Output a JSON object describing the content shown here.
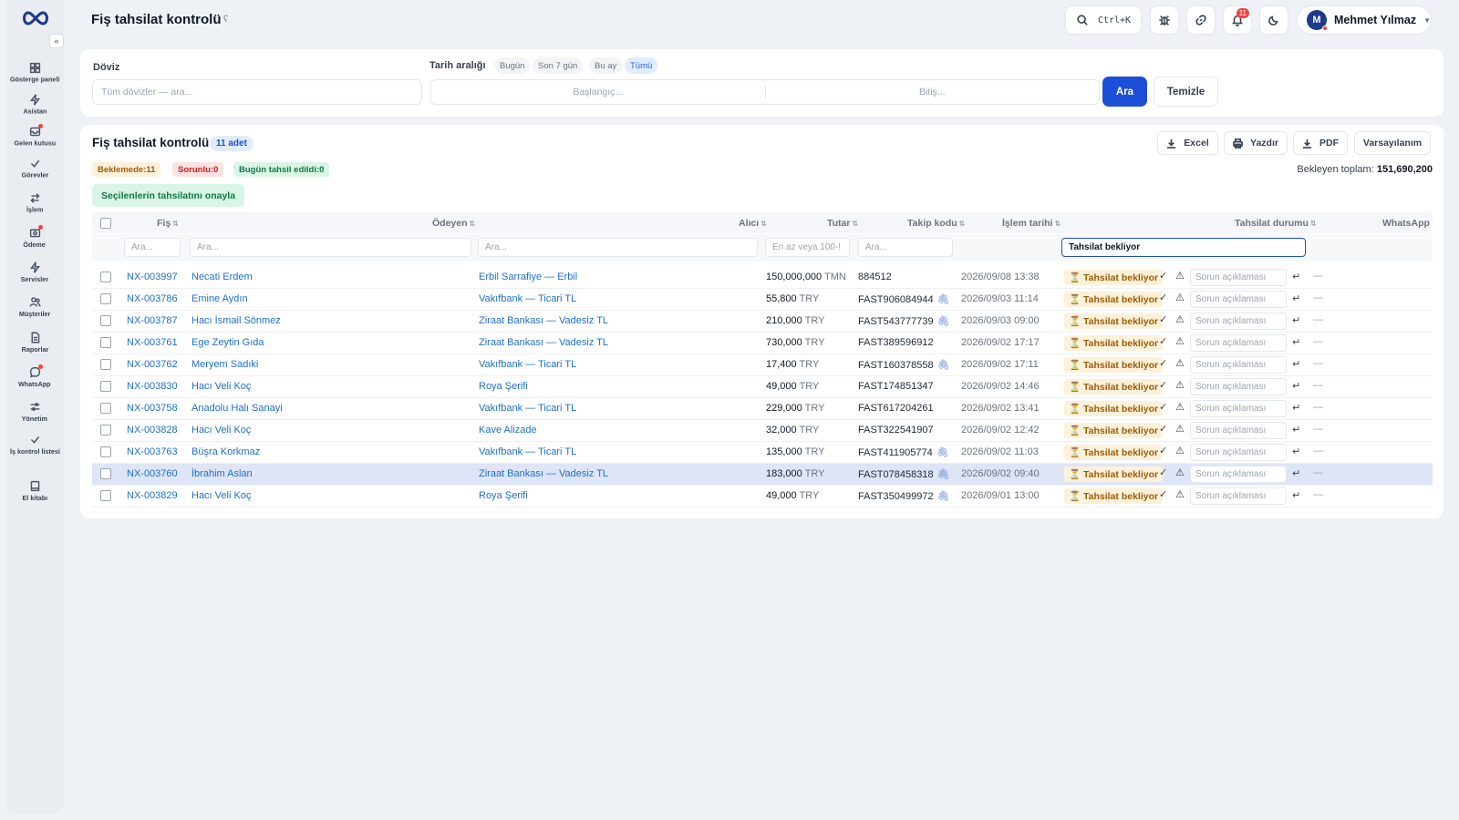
{
  "app": {
    "title": "Fiş tahsilat kontrolü"
  },
  "sidebar": {
    "items": [
      {
        "label": "Gösterge paneli",
        "icon": "dashboard-icon"
      },
      {
        "label": "Asistan",
        "icon": "bolt-icon"
      },
      {
        "label": "Gelen kutusu",
        "icon": "inbox-icon"
      },
      {
        "label": "Görevler",
        "icon": "check-icon"
      },
      {
        "label": "İşlem",
        "icon": "swap-icon"
      },
      {
        "label": "Ödeme",
        "icon": "payment-icon"
      },
      {
        "label": "Servisler",
        "icon": "bolt-icon"
      },
      {
        "label": "Müşteriler",
        "icon": "users-icon"
      },
      {
        "label": "Raporlar",
        "icon": "report-icon"
      },
      {
        "label": "WhatsApp",
        "icon": "chat-icon"
      },
      {
        "label": "Yönetim",
        "icon": "sliders-icon"
      },
      {
        "label": "İş kontrol listesi",
        "icon": "check-icon"
      },
      {
        "label": "El kitabı",
        "icon": "book-icon"
      }
    ]
  },
  "header": {
    "shortcut": "Ctrl+K",
    "notifications": "11",
    "user": {
      "initial": "M",
      "name": "Mehmet Yılmaz"
    }
  },
  "filters": {
    "currency_label": "Döviz",
    "currency_placeholder": "Tüm dövizler — ara...",
    "date_label": "Tarih aralığı",
    "presets": [
      "Bugün",
      "Son 7 gün",
      "Bu ay",
      "Tümü"
    ],
    "start_placeholder": "Başlangıç...",
    "end_placeholder": "Bitiş...",
    "search_button": "Ara",
    "clear_button": "Temizle"
  },
  "main": {
    "title": "Fiş tahsilat kontrolü",
    "count": "11 adet",
    "toolbar": {
      "excel": "Excel",
      "print": "Yazdır",
      "pdf": "PDF",
      "defaults": "Varsayılanım"
    },
    "stats": {
      "pending": "Beklemede:11",
      "problem": "Sorunlu:0",
      "today": "Bugün tahsil edildi:0"
    },
    "total_label": "Bekleyen toplam:",
    "total_value": "151,690,200",
    "approve_button": "Seçilenlerin tahsilatını onayla"
  },
  "table": {
    "columns": {
      "fis": "Fiş",
      "payer": "Ödeyen",
      "receiver": "Alıcı",
      "amount": "Tutar",
      "tracking": "Takip kodu",
      "date": "İşlem tarihi",
      "status": "Tahsilat durumu",
      "whatsapp": "WhatsApp"
    },
    "filters": {
      "fis": "Ara...",
      "payer": "Ara...",
      "receiver": "Ara...",
      "amount": "En az veya 100-!",
      "tracking": "Ara...",
      "status": "Tahsilat bekliyor"
    },
    "status_text": "Tahsilat bekliyor",
    "issue_placeholder": "Sorun açıklaması",
    "rows": [
      {
        "fis": "NX-003997",
        "payer": "Necati Erdem",
        "receiver": "Erbil Sarrafiye — Erbil",
        "amount": "150,000,000",
        "ccy": "TMN",
        "tracking": "884512",
        "clip": false,
        "date": "2026/09/08 13:38"
      },
      {
        "fis": "NX-003786",
        "payer": "Emine Aydın",
        "receiver": "Vakıfbank — Ticari TL",
        "amount": "55,800",
        "ccy": "TRY",
        "tracking": "FAST906084944",
        "clip": true,
        "date": "2026/09/03 11:14"
      },
      {
        "fis": "NX-003787",
        "payer": "Hacı İsmail Sönmez",
        "receiver": "Ziraat Bankası — Vadesiz TL",
        "amount": "210,000",
        "ccy": "TRY",
        "tracking": "FAST543777739",
        "clip": true,
        "date": "2026/09/03 09:00"
      },
      {
        "fis": "NX-003761",
        "payer": "Ege Zeytin Gıda",
        "receiver": "Ziraat Bankası — Vadesiz TL",
        "amount": "730,000",
        "ccy": "TRY",
        "tracking": "FAST389596912",
        "clip": false,
        "date": "2026/09/02 17:17"
      },
      {
        "fis": "NX-003762",
        "payer": "Meryem Sadıki",
        "receiver": "Vakıfbank — Ticari TL",
        "amount": "17,400",
        "ccy": "TRY",
        "tracking": "FAST160378558",
        "clip": true,
        "date": "2026/09/02 17:11"
      },
      {
        "fis": "NX-003830",
        "payer": "Hacı Veli Koç",
        "receiver": "Roya Şerifi",
        "amount": "49,000",
        "ccy": "TRY",
        "tracking": "FAST174851347",
        "clip": false,
        "date": "2026/09/02 14:46"
      },
      {
        "fis": "NX-003758",
        "payer": "Anadolu Halı Sanayi",
        "receiver": "Vakıfbank — Ticari TL",
        "amount": "229,000",
        "ccy": "TRY",
        "tracking": "FAST617204261",
        "clip": false,
        "date": "2026/09/02 13:41"
      },
      {
        "fis": "NX-003828",
        "payer": "Hacı Veli Koç",
        "receiver": "Kave Alizade",
        "amount": "32,000",
        "ccy": "TRY",
        "tracking": "FAST322541907",
        "clip": false,
        "date": "2026/09/02 12:42"
      },
      {
        "fis": "NX-003763",
        "payer": "Büşra Korkmaz",
        "receiver": "Vakıfbank — Ticari TL",
        "amount": "135,000",
        "ccy": "TRY",
        "tracking": "FAST411905774",
        "clip": true,
        "date": "2026/09/02 11:03"
      },
      {
        "fis": "NX-003760",
        "payer": "İbrahim Aslan",
        "receiver": "Ziraat Bankası — Vadesiz TL",
        "amount": "183,000",
        "ccy": "TRY",
        "tracking": "FAST078458318",
        "clip": true,
        "date": "2026/09/02 09:40",
        "selected": true
      },
      {
        "fis": "NX-003829",
        "payer": "Hacı Veli Koç",
        "receiver": "Roya Şerifi",
        "amount": "49,000",
        "ccy": "TRY",
        "tracking": "FAST350499972",
        "clip": true,
        "date": "2026/09/01 13:00"
      }
    ]
  }
}
